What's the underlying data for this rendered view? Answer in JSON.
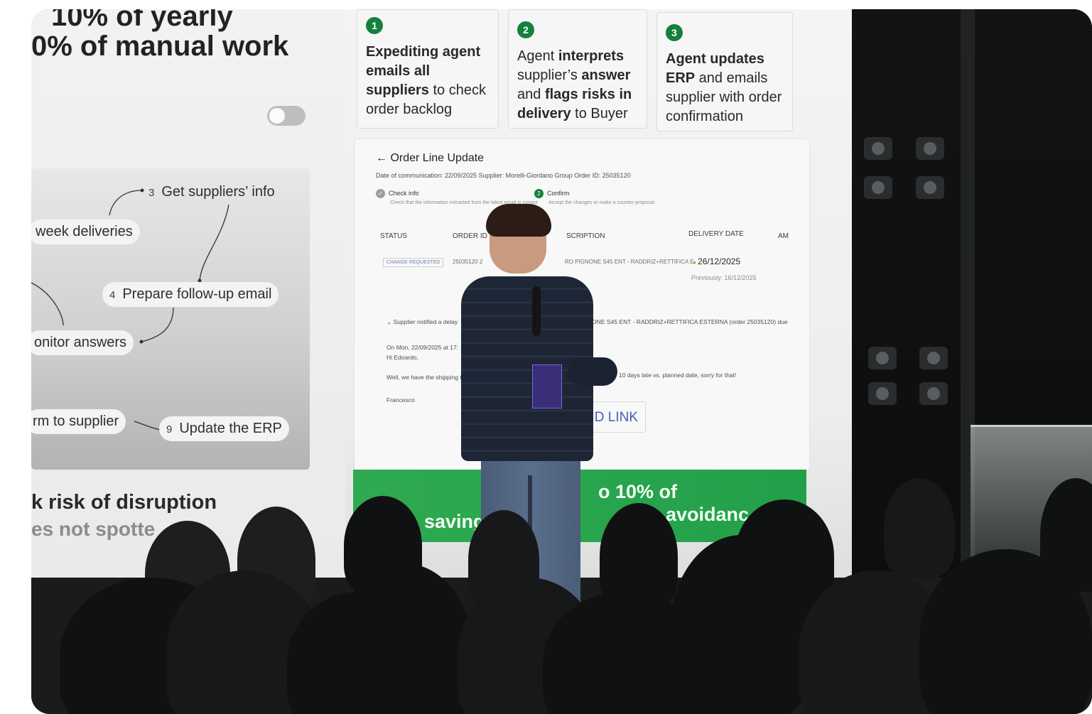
{
  "screen_left": {
    "headline_line1": "10% of yearly",
    "headline_line2": "0% of manual work",
    "steps": {
      "s3_num": "3",
      "s3_label": "Get suppliers’ info",
      "week": "week deliveries",
      "s4_num": "4",
      "s4_label": "Prepare follow-up email",
      "monitor": "onitor answers",
      "confirm": "rm to supplier",
      "s9_num": "9",
      "s9_label": "Update the ERP"
    },
    "bottom_line1": "k risk of disruption",
    "bottom_line2": "es not spotte"
  },
  "cards": [
    {
      "num": "1",
      "html_parts": [
        "Expediting agent emails all suppliers",
        " to check order backlog"
      ]
    },
    {
      "num": "2",
      "pre": "Agent ",
      "b1": "interprets",
      "mid1": " supplier’s ",
      "b2": "answer",
      "mid2": " and ",
      "b3": "flags risks in delivery",
      "post": " to Buyer"
    },
    {
      "num": "3",
      "b1": "Agent updates ERP",
      "post": " and emails supplier with order confirmation"
    }
  ],
  "order_line_update": {
    "title": "← Order Line Update",
    "meta": "Date of communication: 22/09/2025    Supplier: Morelli-Giordano Group    Order ID: 25035120",
    "tab1": "Check info",
    "tab1_sub": "Check that the information extracted from the latest email is correct",
    "tab2_num": "2",
    "tab2": "Confirm",
    "tab2_sub": "Accept the changes or make a counter-proposal",
    "col_status": "STATUS",
    "col_order": "ORDER ID",
    "col_desc": "SCRIPTION",
    "col_delivery": "DELIVERY DATE",
    "col_am": "AM",
    "row_status": "CHANGE REQUESTED",
    "row_order": "25035120  2",
    "row_desc": "RO PIGNONE S45 ENT - RADDRIZ+RETTIFICA E",
    "row_delivery": "26/12/2025",
    "row_previous": "Previously: 16/12/2025",
    "email_notice": "⌄  Supplier notified a delay",
    "email_notice_right": "NONE S45 ENT - RADDRIZ+RETTIFICA ESTERNA (order 25035120) due",
    "email_on": "On Mon, 22/09/2025 at 17:",
    "email_hi": "Hi Edoardo,",
    "email_body": "Well, we have the shipping t",
    "email_body_right": "10 days late vs. planned date, sorry for that!",
    "email_sign": "Francesco",
    "link": "D LINK"
  },
  "banner": {
    "top": "o 10% of",
    "left": "saving",
    "right": "avoidanc"
  },
  "colors": {
    "accent_green": "#15803d",
    "banner_green": "#2faa52"
  }
}
